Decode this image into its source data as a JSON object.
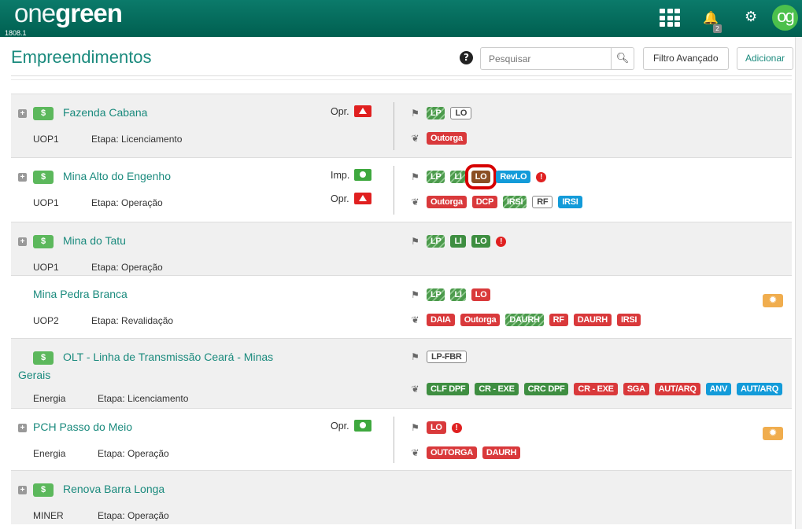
{
  "header": {
    "logo_light": "one",
    "logo_bold": "green",
    "version": "1808.1",
    "notification_count": "2",
    "avatar_text": "og",
    "apps_icon": "grid-icon",
    "bell_icon": "bell-icon",
    "settings_icon": "gear-icon"
  },
  "page": {
    "title": "Empreendimentos",
    "search_placeholder": "Pesquisar",
    "search_value": "",
    "filter_label": "Filtro Avançado",
    "add_label": "Adicionar"
  },
  "colors": {
    "brand": "#00705f",
    "title": "#1a8a7d",
    "red": "#d9393b",
    "green": "#3e8e41",
    "blue": "#139bd9",
    "highlight": "#d60000"
  },
  "rows": [
    {
      "name": "Fazenda Cabana",
      "expandable": true,
      "type": "dollar",
      "unit": "UOP1",
      "etapa": "Etapa: Licenciamento",
      "statuses": [
        {
          "label": "Opr.",
          "icon": "triangle"
        }
      ],
      "flag_tags": [
        {
          "text": "LP",
          "style": "striped"
        },
        {
          "text": "LO",
          "style": "outline"
        }
      ],
      "flag_alert": false,
      "leaf_tags": [
        {
          "text": "Outorga",
          "style": "red"
        }
      ]
    },
    {
      "name": "Mina Alto do Engenho",
      "expandable": true,
      "type": "dollar",
      "unit": "UOP1",
      "etapa": "Etapa: Operação",
      "statuses": [
        {
          "label": "Imp.",
          "icon": "dot"
        },
        {
          "label": "Opr.",
          "icon": "triangle"
        }
      ],
      "flag_tags": [
        {
          "text": "LP",
          "style": "striped"
        },
        {
          "text": "LI",
          "style": "striped"
        },
        {
          "text": "LO",
          "style": "brown"
        },
        {
          "text": "RevLO",
          "style": "blue"
        }
      ],
      "flag_alert": true,
      "leaf_tags": [
        {
          "text": "Outorga",
          "style": "red"
        },
        {
          "text": "DCP",
          "style": "red"
        },
        {
          "text": "IRSI",
          "style": "striped"
        },
        {
          "text": "RF",
          "style": "outline"
        },
        {
          "text": "IRSI",
          "style": "blue"
        }
      ]
    },
    {
      "name": "Mina do Tatu",
      "expandable": true,
      "type": "dollar",
      "unit": "UOP1",
      "etapa": "Etapa: Operação",
      "statuses": [],
      "flag_tags": [
        {
          "text": "LP",
          "style": "striped"
        },
        {
          "text": "LI",
          "style": "green"
        },
        {
          "text": "LO",
          "style": "green"
        }
      ],
      "flag_alert": true,
      "leaf_tags": []
    },
    {
      "name": "Mina Pedra Branca",
      "expandable": false,
      "type": "gear",
      "unit": "UOP2",
      "etapa": "Etapa: Revalidação",
      "statuses": [],
      "flag_tags": [
        {
          "text": "LP",
          "style": "striped"
        },
        {
          "text": "LI",
          "style": "striped"
        },
        {
          "text": "LO",
          "style": "red"
        }
      ],
      "flag_alert": false,
      "leaf_tags": [
        {
          "text": "DAIA",
          "style": "red"
        },
        {
          "text": "Outorga",
          "style": "red"
        },
        {
          "text": "DAURH",
          "style": "striped"
        },
        {
          "text": "RF",
          "style": "red"
        },
        {
          "text": "DAURH",
          "style": "red"
        },
        {
          "text": "IRSI",
          "style": "red"
        }
      ]
    },
    {
      "name": "OLT - Linha de Transmissão Ceará - Minas Gerais",
      "expandable": false,
      "type": "dollar",
      "unit": "Energia",
      "etapa": "Etapa: Licenciamento",
      "statuses": [],
      "flag_tags": [
        {
          "text": "LP-FBR",
          "style": "outline"
        }
      ],
      "flag_alert": false,
      "leaf_tags": [
        {
          "text": "CLF DPF",
          "style": "green"
        },
        {
          "text": "CR - EXE",
          "style": "green"
        },
        {
          "text": "CRC DPF",
          "style": "green"
        },
        {
          "text": "CR - EXE",
          "style": "red"
        },
        {
          "text": "SGA",
          "style": "red"
        },
        {
          "text": "AUT/ARQ",
          "style": "red"
        },
        {
          "text": "ANV",
          "style": "blue"
        },
        {
          "text": "AUT/ARQ",
          "style": "blue"
        }
      ]
    },
    {
      "name": "PCH Passo do Meio",
      "expandable": true,
      "type": "gear",
      "unit": "Energia",
      "etapa": "Etapa: Operação",
      "statuses": [
        {
          "label": "Opr.",
          "icon": "dot"
        }
      ],
      "flag_tags": [
        {
          "text": "LO",
          "style": "red"
        }
      ],
      "flag_alert": true,
      "leaf_tags": [
        {
          "text": "OUTORGA",
          "style": "red"
        },
        {
          "text": "DAURH",
          "style": "red"
        }
      ]
    },
    {
      "name": "Renova Barra Longa",
      "expandable": true,
      "type": "dollar",
      "unit": "MINER",
      "etapa": "Etapa: Operação",
      "statuses": [],
      "flag_tags": [],
      "flag_alert": false,
      "leaf_tags": []
    }
  ]
}
